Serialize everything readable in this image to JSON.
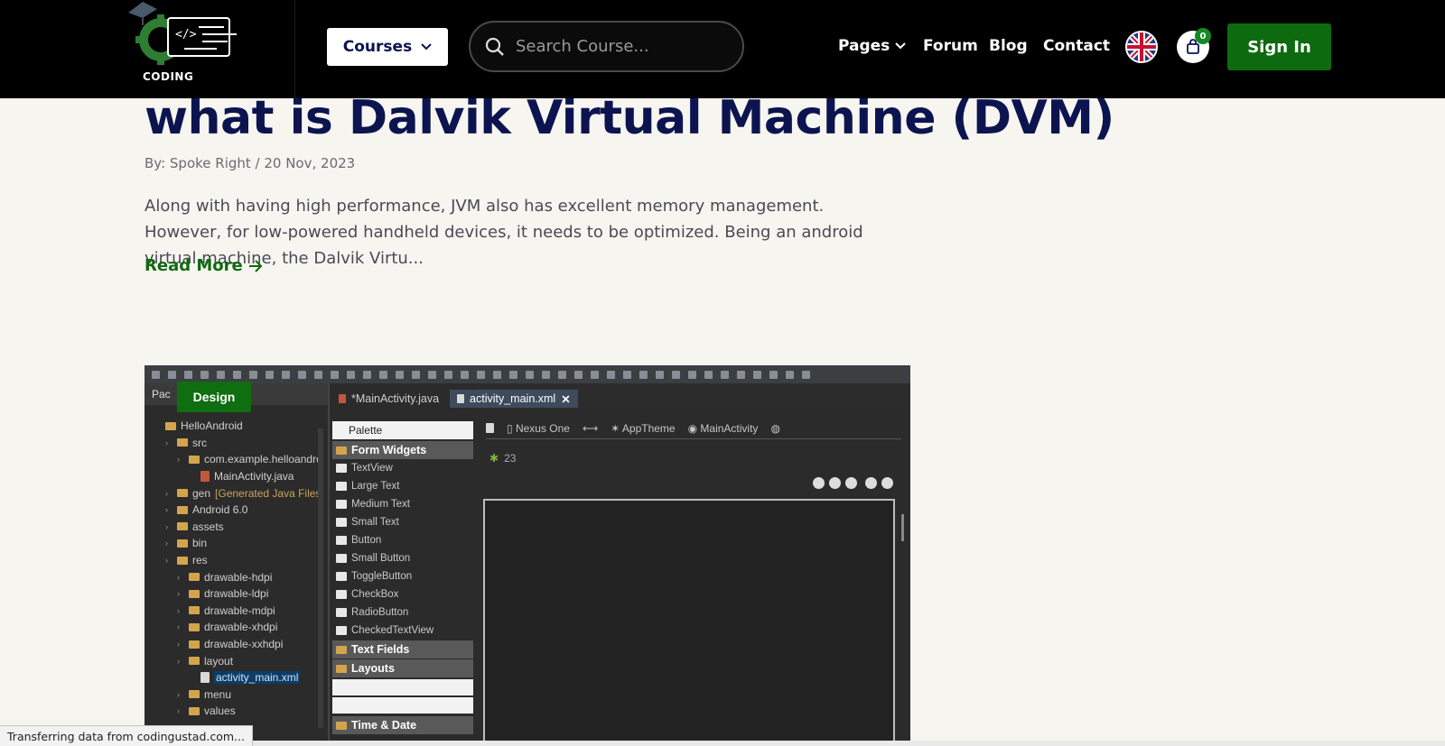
{
  "header": {
    "logo_text": "CODING",
    "courses_label": "Courses",
    "search_placeholder": "Search Course...",
    "nav": [
      {
        "label": "Pages",
        "has_dropdown": true
      },
      {
        "label": "Forum"
      },
      {
        "label": "Blog"
      },
      {
        "label": "Contact"
      }
    ],
    "cart_count": "0",
    "signin_label": "Sign In",
    "language_flag": "uk-flag-icon"
  },
  "post": {
    "title": "what is Dalvik Virtual Machine (DVM)",
    "meta": "By: Spoke Right / 20 Nov, 2023",
    "excerpt": "Along with having high performance, JVM also has excellent memory management. However, for low-powered handheld devices, it needs to be optimized. Being an android virtual machine, the Dalvik Virtu...",
    "read_more": "Read More"
  },
  "ide": {
    "badge": "Design",
    "left_tab": "Pac",
    "tabs": [
      "*MainActivity.java",
      "activity_main.xml"
    ],
    "tree": [
      {
        "label": "HelloAndroid",
        "indent": 0,
        "type": "project"
      },
      {
        "label": "src",
        "indent": 1,
        "type": "folder"
      },
      {
        "label": "com.example.helloandro",
        "indent": 2,
        "type": "package"
      },
      {
        "label": "MainActivity.java",
        "indent": 3,
        "type": "java"
      },
      {
        "label": "gen",
        "extra": "[Generated Java Files]",
        "indent": 1,
        "type": "folder"
      },
      {
        "label": "Android 6.0",
        "indent": 1,
        "type": "lib"
      },
      {
        "label": "assets",
        "indent": 1,
        "type": "folder"
      },
      {
        "label": "bin",
        "indent": 1,
        "type": "folder"
      },
      {
        "label": "res",
        "indent": 1,
        "type": "folder"
      },
      {
        "label": "drawable-hdpi",
        "indent": 2,
        "type": "folder"
      },
      {
        "label": "drawable-ldpi",
        "indent": 2,
        "type": "folder"
      },
      {
        "label": "drawable-mdpi",
        "indent": 2,
        "type": "folder"
      },
      {
        "label": "drawable-xhdpi",
        "indent": 2,
        "type": "folder"
      },
      {
        "label": "drawable-xxhdpi",
        "indent": 2,
        "type": "folder"
      },
      {
        "label": "layout",
        "indent": 2,
        "type": "folder"
      },
      {
        "label": "activity_main.xml",
        "indent": 3,
        "type": "xml",
        "selected": true
      },
      {
        "label": "menu",
        "indent": 2,
        "type": "folder"
      },
      {
        "label": "values",
        "indent": 2,
        "type": "folder"
      }
    ],
    "palette_label": "Palette",
    "palette_title": "Palette",
    "groups": {
      "form_widgets": "Form Widgets",
      "text_fields": "Text Fields",
      "layouts": "Layouts",
      "time_date": "Time & Date"
    },
    "widgets": [
      "TextView",
      "Large Text",
      "Medium Text",
      "Small Text",
      "Button",
      "Small Button",
      "ToggleButton",
      "CheckBox",
      "RadioButton",
      "CheckedTextView"
    ],
    "device": "Nexus One",
    "theme": "AppTheme",
    "activity": "MainActivity",
    "api_level": "23"
  },
  "status": {
    "text": "Transferring data from codingustad.com..."
  }
}
